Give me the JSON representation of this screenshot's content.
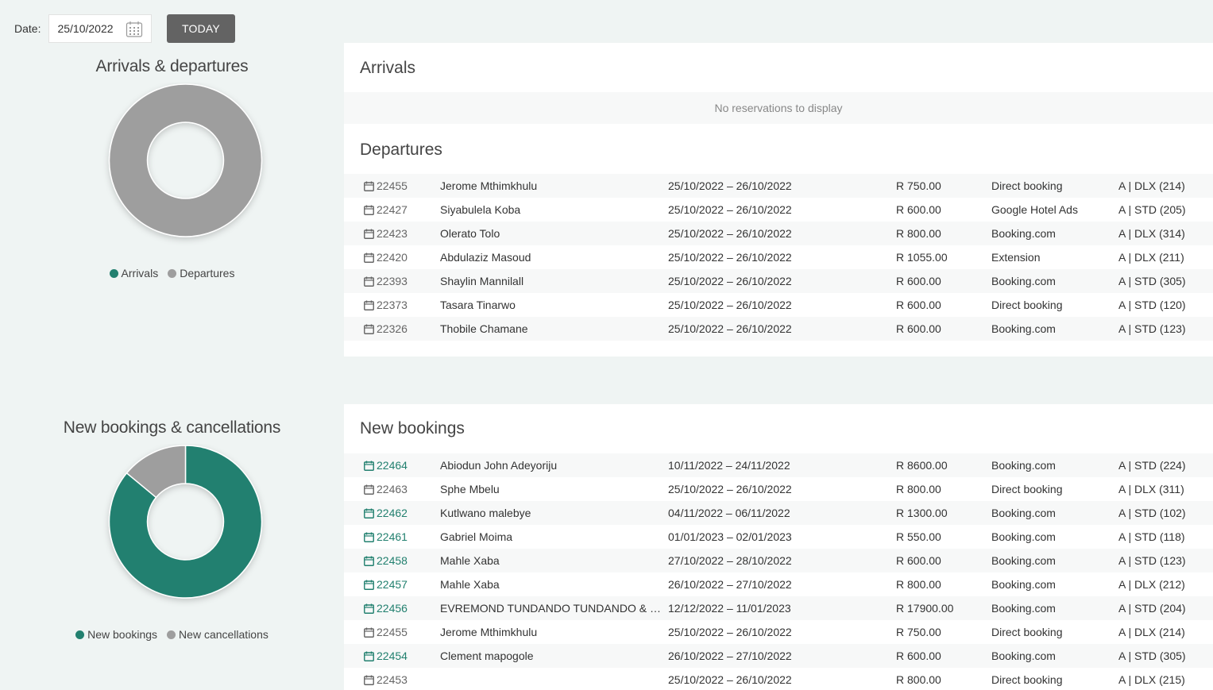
{
  "header": {
    "date_label": "Date:",
    "date_value": "25/10/2022",
    "today_label": "TODAY"
  },
  "colors": {
    "accent": "#22806f",
    "grey": "#9e9e9e"
  },
  "chart1": {
    "title": "Arrivals & departures",
    "legend": [
      "Arrivals",
      "Departures"
    ]
  },
  "chart2": {
    "title": "New bookings & cancellations",
    "legend": [
      "New bookings",
      "New cancellations"
    ]
  },
  "chart_data": [
    {
      "type": "pie",
      "title": "Arrivals & departures",
      "categories": [
        "Arrivals",
        "Departures"
      ],
      "values": [
        0,
        7
      ],
      "colors": [
        "#22806f",
        "#9e9e9e"
      ],
      "legend": "bottom"
    },
    {
      "type": "pie",
      "title": "New bookings & cancellations",
      "categories": [
        "New bookings",
        "New cancellations"
      ],
      "values": [
        86,
        14
      ],
      "colors": [
        "#22806f",
        "#9e9e9e"
      ],
      "legend": "bottom"
    }
  ],
  "arrivals": {
    "title": "Arrivals",
    "empty_text": "No reservations to display"
  },
  "departures": {
    "title": "Departures",
    "rows": [
      {
        "id": "22455",
        "name": "Jerome Mthimkhulu",
        "dates": "25/10/2022 – 26/10/2022",
        "price": "R 750.00",
        "source": "Direct booking",
        "room": "A | DLX (214)",
        "is_new": false
      },
      {
        "id": "22427",
        "name": "Siyabulela Koba",
        "dates": "25/10/2022 – 26/10/2022",
        "price": "R 600.00",
        "source": "Google Hotel Ads",
        "room": "A | STD (205)",
        "is_new": false
      },
      {
        "id": "22423",
        "name": "Olerato Tolo",
        "dates": "25/10/2022 – 26/10/2022",
        "price": "R 800.00",
        "source": "Booking.com",
        "room": "A | DLX (314)",
        "is_new": false
      },
      {
        "id": "22420",
        "name": "Abdulaziz Masoud",
        "dates": "25/10/2022 – 26/10/2022",
        "price": "R 1055.00",
        "source": "Extension",
        "room": "A | DLX (211)",
        "is_new": false
      },
      {
        "id": "22393",
        "name": "Shaylin Mannilall",
        "dates": "25/10/2022 – 26/10/2022",
        "price": "R 600.00",
        "source": "Booking.com",
        "room": "A | STD (305)",
        "is_new": false
      },
      {
        "id": "22373",
        "name": "Tasara Tinarwo",
        "dates": "25/10/2022 – 26/10/2022",
        "price": "R 600.00",
        "source": "Direct booking",
        "room": "A | STD (120)",
        "is_new": false
      },
      {
        "id": "22326",
        "name": "Thobile Chamane",
        "dates": "25/10/2022 – 26/10/2022",
        "price": "R 600.00",
        "source": "Booking.com",
        "room": "A | STD (123)",
        "is_new": false
      }
    ]
  },
  "new_bookings": {
    "title": "New bookings",
    "rows": [
      {
        "id": "22464",
        "name": "Abiodun John Adeyoriju",
        "dates": "10/11/2022 – 24/11/2022",
        "price": "R 8600.00",
        "source": "Booking.com",
        "room": "A | STD (224)",
        "is_new": true
      },
      {
        "id": "22463",
        "name": "Sphe Mbelu",
        "dates": "25/10/2022 – 26/10/2022",
        "price": "R 800.00",
        "source": "Direct booking",
        "room": "A | DLX (311)",
        "is_new": false
      },
      {
        "id": "22462",
        "name": "Kutlwano malebye",
        "dates": "04/11/2022 – 06/11/2022",
        "price": "R 1300.00",
        "source": "Booking.com",
        "room": "A | STD (102)",
        "is_new": true
      },
      {
        "id": "22461",
        "name": "Gabriel Moima",
        "dates": "01/01/2023 – 02/01/2023",
        "price": "R 550.00",
        "source": "Booking.com",
        "room": "A | STD (118)",
        "is_new": true
      },
      {
        "id": "22458",
        "name": "Mahle Xaba",
        "dates": "27/10/2022 – 28/10/2022",
        "price": "R 600.00",
        "source": "Booking.com",
        "room": "A | STD (123)",
        "is_new": true
      },
      {
        "id": "22457",
        "name": "Mahle Xaba",
        "dates": "26/10/2022 – 27/10/2022",
        "price": "R 800.00",
        "source": "Booking.com",
        "room": "A | DLX (212)",
        "is_new": true
      },
      {
        "id": "22456",
        "name": "EVREMOND TUNDANDO TUNDANDO & NAH…",
        "dates": "12/12/2022 – 11/01/2023",
        "price": "R 17900.00",
        "source": "Booking.com",
        "room": "A | STD (204)",
        "is_new": true
      },
      {
        "id": "22455",
        "name": "Jerome Mthimkhulu",
        "dates": "25/10/2022 – 26/10/2022",
        "price": "R 750.00",
        "source": "Direct booking",
        "room": "A | DLX (214)",
        "is_new": false
      },
      {
        "id": "22454",
        "name": "Clement mapogole",
        "dates": "26/10/2022 – 27/10/2022",
        "price": "R 600.00",
        "source": "Booking.com",
        "room": "A | STD (305)",
        "is_new": true
      },
      {
        "id": "22453",
        "name": "",
        "dates": "25/10/2022 – 26/10/2022",
        "price": "R 800.00",
        "source": "Direct booking",
        "room": "A | DLX (215)",
        "is_new": false
      }
    ]
  }
}
